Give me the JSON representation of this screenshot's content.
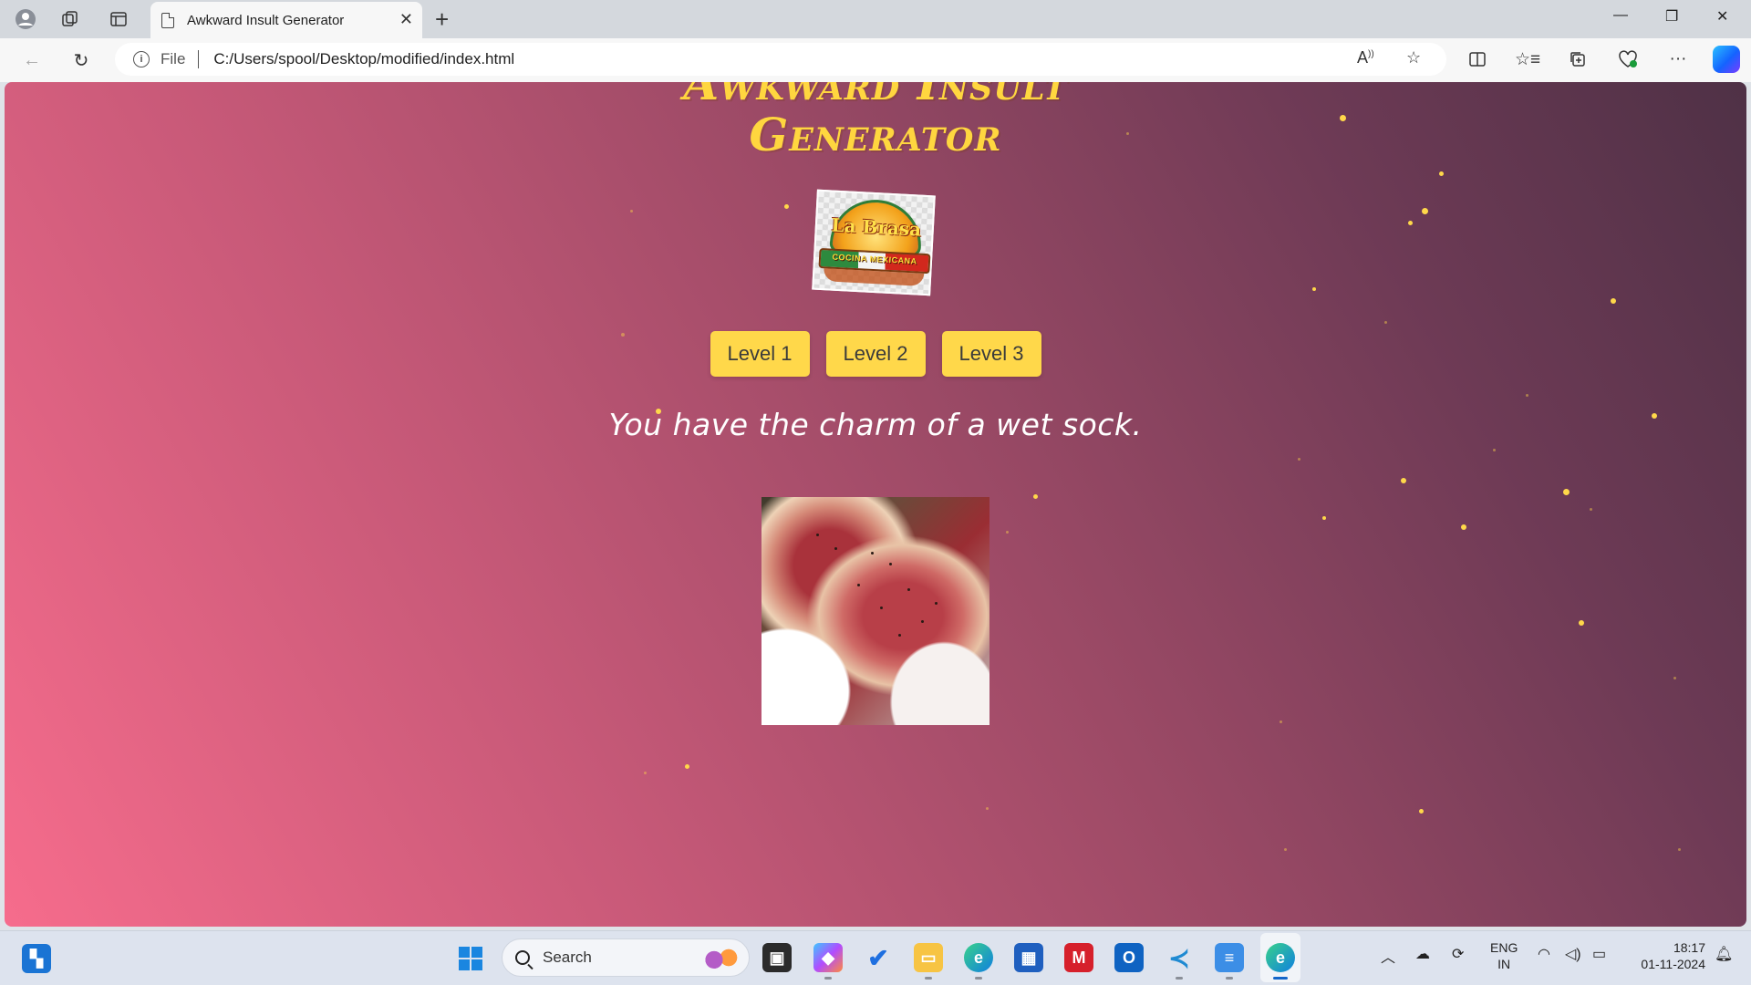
{
  "browser": {
    "tab_title": "Awkward Insult Generator",
    "address_label": "File",
    "url": "C:/Users/spool/Desktop/modified/index.html"
  },
  "page": {
    "title": "Awkward Insult Generator",
    "title_visible": "Generator",
    "logo": {
      "name": "La Brasa",
      "tagline": "COCINA MEXICANA"
    },
    "levels": [
      "Level 1",
      "Level 2",
      "Level 3"
    ],
    "insult": "You have the charm of a wet sock.",
    "image_subject": "raw steak",
    "colors": {
      "accent": "#ffd84a",
      "gradient_start": "#f66c8c",
      "gradient_end": "#4f3146"
    }
  },
  "taskbar": {
    "search_placeholder": "Search",
    "lang_line1": "ENG",
    "lang_line2": "IN",
    "time": "18:17",
    "date": "01-11-2024"
  }
}
